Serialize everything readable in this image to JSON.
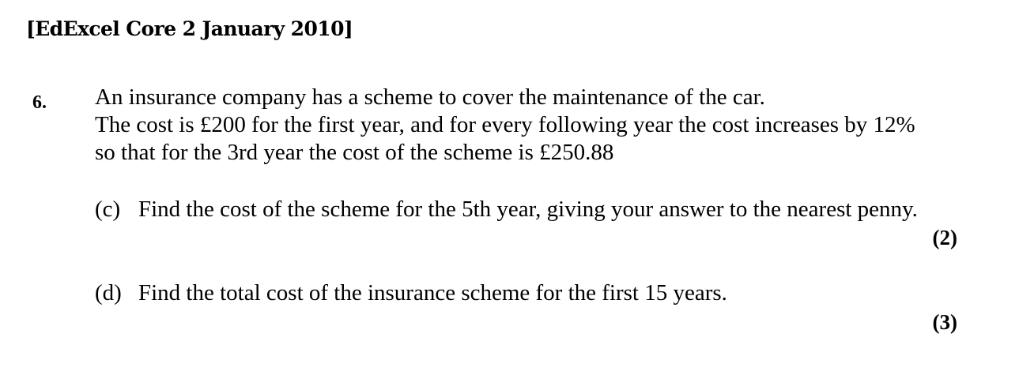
{
  "source": "[EdExcel Core 2 January 2010]",
  "question": {
    "number": "6.",
    "intro": [
      "An insurance company has a scheme to cover the maintenance of the car.",
      "The cost is £200 for the first year, and for every following year the cost increases by 12%",
      "so that for the 3rd year the cost of the scheme is £250.88"
    ],
    "parts": [
      {
        "label": "(c)",
        "text": "Find the cost of the scheme for the 5th year, giving your answer to the nearest penny.",
        "marks": "(2)"
      },
      {
        "label": "(d)",
        "text": "Find the total cost of the insurance scheme for the first 15 years.",
        "marks": "(3)"
      }
    ]
  }
}
